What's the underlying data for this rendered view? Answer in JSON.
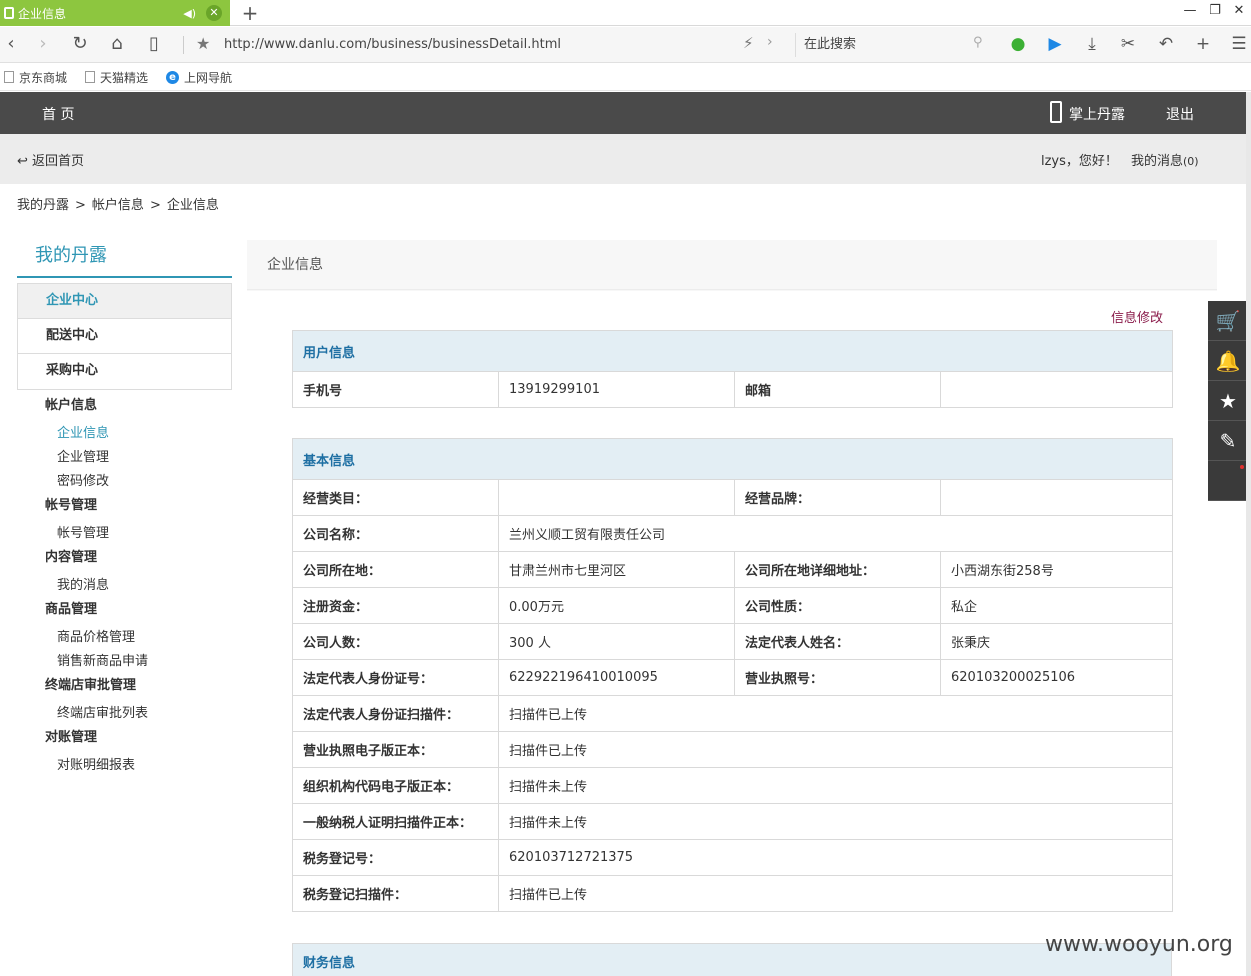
{
  "browser": {
    "tab_title": "企业信息",
    "url": "http://www.danlu.com/business/businessDetail.html",
    "search_placeholder": "在此搜索",
    "bookmarks": [
      "京东商城",
      "天猫精选",
      "上网导航"
    ]
  },
  "header": {
    "home": "首 页",
    "mobile": "掌上丹露",
    "logout": "退出"
  },
  "subheader": {
    "back": "返回首页",
    "greeting": "lzys，您好！",
    "messages": "我的消息",
    "messages_count": "(0)"
  },
  "breadcrumb": [
    "我的丹露",
    "帐户信息",
    "企业信息"
  ],
  "breadcrumb_sep": ">",
  "sidebar": {
    "title": "我的丹露",
    "boxes": [
      "企业中心",
      "配送中心",
      "采购中心"
    ],
    "groups": [
      {
        "label": "帐户信息",
        "items": [
          "企业信息",
          "企业管理",
          "密码修改"
        ]
      },
      {
        "label": "帐号管理",
        "items": [
          "帐号管理"
        ]
      },
      {
        "label": "内容管理",
        "items": [
          "我的消息"
        ]
      },
      {
        "label": "商品管理",
        "items": [
          "商品价格管理",
          "销售新商品申请"
        ]
      },
      {
        "label": "终端店审批管理",
        "items": [
          "终端店审批列表"
        ]
      },
      {
        "label": "对账管理",
        "items": [
          "对账明细报表"
        ]
      }
    ]
  },
  "main": {
    "title": "企业信息",
    "edit": "信息修改",
    "user_section": {
      "title": "用户信息",
      "phone_label": "手机号",
      "phone": "13919299101",
      "email_label": "邮箱",
      "email": ""
    },
    "basic_section": {
      "title": "基本信息",
      "rows": [
        {
          "k1": "经营类目：",
          "v1": "",
          "k2": "经营品牌：",
          "v2": ""
        },
        {
          "k1": "公司名称：",
          "v1": "兰州义顺工贸有限责任公司"
        },
        {
          "k1": "公司所在地：",
          "v1": "甘肃兰州市七里河区",
          "k2": "公司所在地详细地址：",
          "v2": "小西湖东街258号"
        },
        {
          "k1": "注册资金：",
          "v1": "0.00万元",
          "k2": "公司性质：",
          "v2": "私企"
        },
        {
          "k1": "公司人数：",
          "v1": "300 人",
          "k2": "法定代表人姓名：",
          "v2": "张秉庆"
        },
        {
          "k1": "法定代表人身份证号：",
          "v1": "622922196410010095",
          "k2": "营业执照号：",
          "v2": "620103200025106"
        },
        {
          "k1": "法定代表人身份证扫描件：",
          "v1": "扫描件已上传"
        },
        {
          "k1": "营业执照电子版正本：",
          "v1": "扫描件已上传"
        },
        {
          "k1": "组织机构代码电子版正本：",
          "v1": "扫描件未上传"
        },
        {
          "k1": "一般纳税人证明扫描件正本：",
          "v1": "扫描件未上传"
        },
        {
          "k1": "税务登记号：",
          "v1": "620103712721375"
        },
        {
          "k1": "税务登记扫描件：",
          "v1": "扫描件已上传"
        }
      ]
    },
    "finance_section": {
      "title": "财务信息"
    }
  },
  "watermark": "www.wooyun.org"
}
